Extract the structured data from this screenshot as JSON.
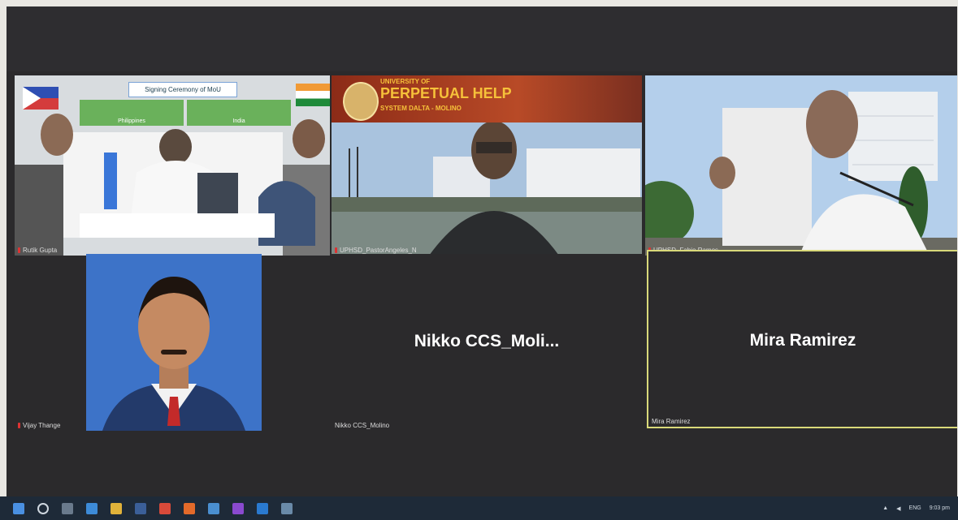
{
  "participants": [
    {
      "name": "Rutik Gupta",
      "tile": "signing-ceremony"
    },
    {
      "name": "UPHSD_PastorAngeles_N",
      "tile": "university-of-perpetual-help"
    },
    {
      "name": "UPHSD_Fabio Ramos",
      "tile": "document-holder"
    },
    {
      "name": "Vijay Thange",
      "tile": "headshot"
    },
    {
      "name": "Nikko CCS_Molino",
      "display_label": "Nikko  CCS_Moli..."
    },
    {
      "name": "Mira Ramirez",
      "display_label": "Mira Ramirez"
    }
  ],
  "signing": {
    "banner": "Signing Ceremony of MoU",
    "left_box": "Philippines",
    "right_box": "India"
  },
  "university_banner": {
    "line1": "UNIVERSITY OF",
    "line2": "PERPETUAL HELP",
    "line3": "SYSTEM DALTA - MOLINO"
  },
  "tray": {
    "lang": "ENG",
    "time": "9:03 pm"
  },
  "colors": {
    "accent_border": "#d9d97a",
    "taskbar": "#1e2a38",
    "background": "#2b2a2c"
  }
}
